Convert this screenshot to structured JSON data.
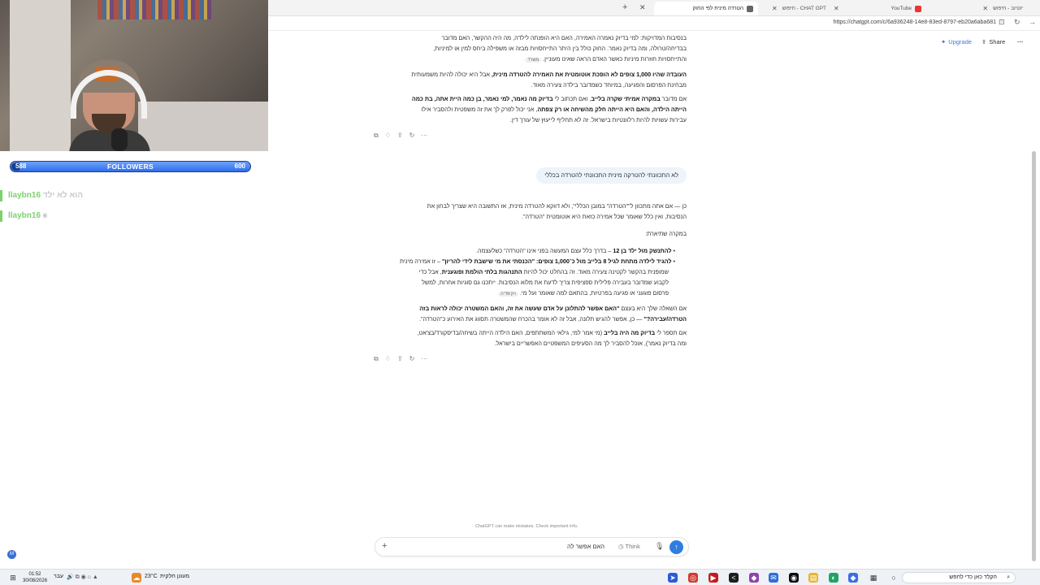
{
  "browser": {
    "tabs": [
      {
        "label": "הטרדה מינית לפי החוק",
        "active": true
      },
      {
        "label": "CHAT GPT - חיפוש",
        "active": false
      },
      {
        "label": "YouTube",
        "active": false
      },
      {
        "label": "יוטיוב - חיפוש",
        "active": false
      }
    ],
    "url": "https://chatgpt.com/c/6a936248-14e8-83ed-8797-eb20a6aba681"
  },
  "header": {
    "upgrade": "Upgrade",
    "share": "Share",
    "more": "···"
  },
  "stream": {
    "followers_current": "588",
    "followers_label": "FOLLOWERS",
    "followers_goal": "600",
    "followers_fraction": 0.98,
    "chat": [
      {
        "user": "llaybn16",
        "msg": "הוא לא ילד"
      },
      {
        "user": "llaybn16",
        "msg": "®"
      }
    ]
  },
  "assistant1": {
    "p1_l1": "בנסיבות המדויקות: למי בדיוק נאמרה האמירה, האם היא הופנתה לילדה, מה היה ההקשר, האם מדובר",
    "p1_l2": "בבדיחה/טרולה, ומה בדיוק נאמר. החוק כולל בין היתר התייחסויות מבזה או משפילה ביחס למין או למיניות,",
    "p1_l3": "והתייחסויות חוזרות מיניות כאשר האדם הראה שאינו מעוניין.",
    "p1_src": "משרד",
    "p2_b": "העובדה שהיו 1,000 צופים לא הופכת אוטומטית את האמירה להטרדה מינית,",
    "p2_rest": " אבל היא יכולה להיות משמעותית",
    "p2_l2": "מבחינת הפרסום והפגיעה, במיוחד כשמדובר בילדה צעירה מאוד.",
    "p3_l1a": "אם מדובר ",
    "p3_l1b": "במקרה אמיתי שקרה בלייב",
    "p3_l1c": ", ואם תכתוב לי ",
    "p3_l1d": "בדיוק מה נאמר, למי נאמר, בן כמה היית אתה, בת כמה",
    "p3_l2a": "הייתה הילדה, והאם היא הייתה חלק מהשיחה או רק צפתה",
    "p3_l2b": ", אני יכול לפרק לך את זה משפטית ולהסביר אילו",
    "p3_l3": "עבירות עשויות להיות רלוונטיות בישראל. זה לא תחליף לייעוץ של עורך דין."
  },
  "user_msg": "לא התכוונתי להטרקה מינית התכוונתי להטרדה בכללי",
  "assistant2": {
    "p1_l1": "כן — אם אתה מתכוון ל\"\"הטרדה\" במובן הכללי\", ולא דווקא להטרדה מינית, אז התשובה היא שצריך לבחון את",
    "p1_l2": "הנסיבות, ואין כלל שאומר שכל אמירה כזאת היא אוטומטית \"הטרדה\".",
    "p2": "במקרה שתיארת:",
    "b1_b": "להתנשק מול ילד בן 12",
    "b1_rest": " – בדרך כלל עצם המעשה בפני אינו \"הטרדה\" כשלעצמה.",
    "b2_b1": "להגיד לילדה מתחת לגיל 8 בלייב מול כ־1,000 צופים:",
    "b2_q": " \"הכנסתי את מי שישבת לידי להריון\"",
    "b2_rest": " – זו אמירה מינית",
    "b2_l2": "שמופנית בהקשר לקטינה צעירה מאוד. זה בהחלט יכול להיות ",
    "b2_l2b": "התנהגות בלתי הולמת ופוגענית",
    "b2_l2c": ", אבל כדי",
    "b2_l3": "לקבוע שמדובר בעבירה פלילית ספציפית צריך לדעת את מלוא הנסיבות. ייתכנו גם סוגיות אחרות, למשל",
    "b2_l4": "פרסום פוגעני או פגיעה בפרטיות, בהתאם למה שאומר ועל מי.",
    "b2_src": "ויקיפדיה",
    "p3_a": "אם השאלה שלך היא בעצם ",
    "p3_b": "\"האם אפשר להתלונן על אדם שעשה את זה, והאם המשטרה יכולה לראות בזה",
    "p3_c": "הטרדה/עבירה?\"",
    "p3_d": " — כן, אפשר להגיש תלונה, אבל זה לא אומר בהכרח שהמשטרה תסווג את האירוע כ\"הטרדה\".",
    "p4_a": "אם תספר לי ",
    "p4_b": "בדיוק מה היה בלייב",
    "p4_c": " (מי אמר למי, גילאי המשתתפים, האם הילדה הייתה בשיחה/בדיסקורד/בצ'אט,",
    "p4_l2": "ומה בדיוק נאמר), אוכל להסביר לך מה הסעיפים המשפטיים האפשריים בישראל."
  },
  "composer": {
    "text": "האם אפשר לה",
    "think": "Think",
    "disclaimer": "ChatGPT can make mistakes. Check important info."
  },
  "taskbar": {
    "weather": "23°C",
    "weather_text": "מעונן חלקית",
    "time": "01:52",
    "date": "30/08/2026",
    "lang": "עבר",
    "search_placeholder": "הקלד כאן כדי לחפש"
  }
}
